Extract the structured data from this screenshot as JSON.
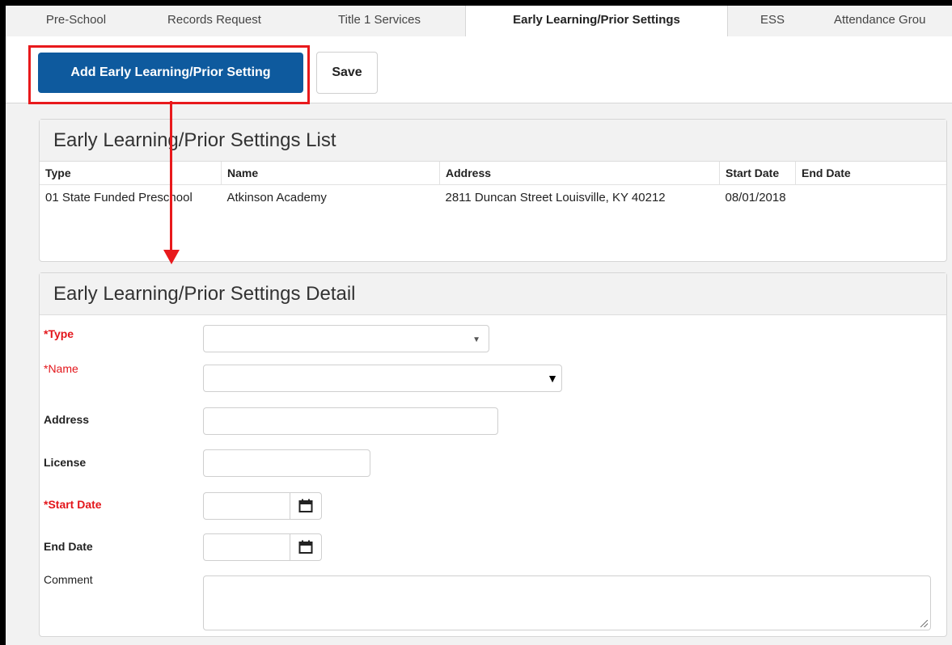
{
  "tabs": [
    {
      "label": "Pre-School"
    },
    {
      "label": "Records Request"
    },
    {
      "label": "Title 1 Services"
    },
    {
      "label": "Early Learning/Prior Settings"
    },
    {
      "label": "ESS"
    },
    {
      "label": "Attendance Grou"
    }
  ],
  "active_tab_index": 3,
  "toolbar": {
    "add_label": "Add Early Learning/Prior Setting",
    "save_label": "Save"
  },
  "list_panel": {
    "title": "Early Learning/Prior Settings List",
    "columns": [
      "Type",
      "Name",
      "Address",
      "Start Date",
      "End Date"
    ],
    "rows": [
      {
        "type": "01 State Funded Preschool",
        "name": "Atkinson Academy",
        "address": "2811 Duncan Street Louisville, KY 40212",
        "start_date": "08/01/2018",
        "end_date": ""
      }
    ]
  },
  "detail_panel": {
    "title": "Early Learning/Prior Settings Detail",
    "labels": {
      "type": "*Type",
      "name": "*Name",
      "address": "Address",
      "license": "License",
      "start_date": "*Start Date",
      "end_date": "End Date",
      "comment": "Comment"
    },
    "values": {
      "type": "",
      "name": "",
      "address": "",
      "license": "",
      "start_date": "",
      "end_date": "",
      "comment": ""
    }
  },
  "colors": {
    "primary_button": "#0e5a9e",
    "required_label": "#e3161b",
    "annotation": "#e8191c"
  },
  "icons": [
    "calendar-icon",
    "dropdown-caret-icon",
    "resize-handle-icon"
  ]
}
